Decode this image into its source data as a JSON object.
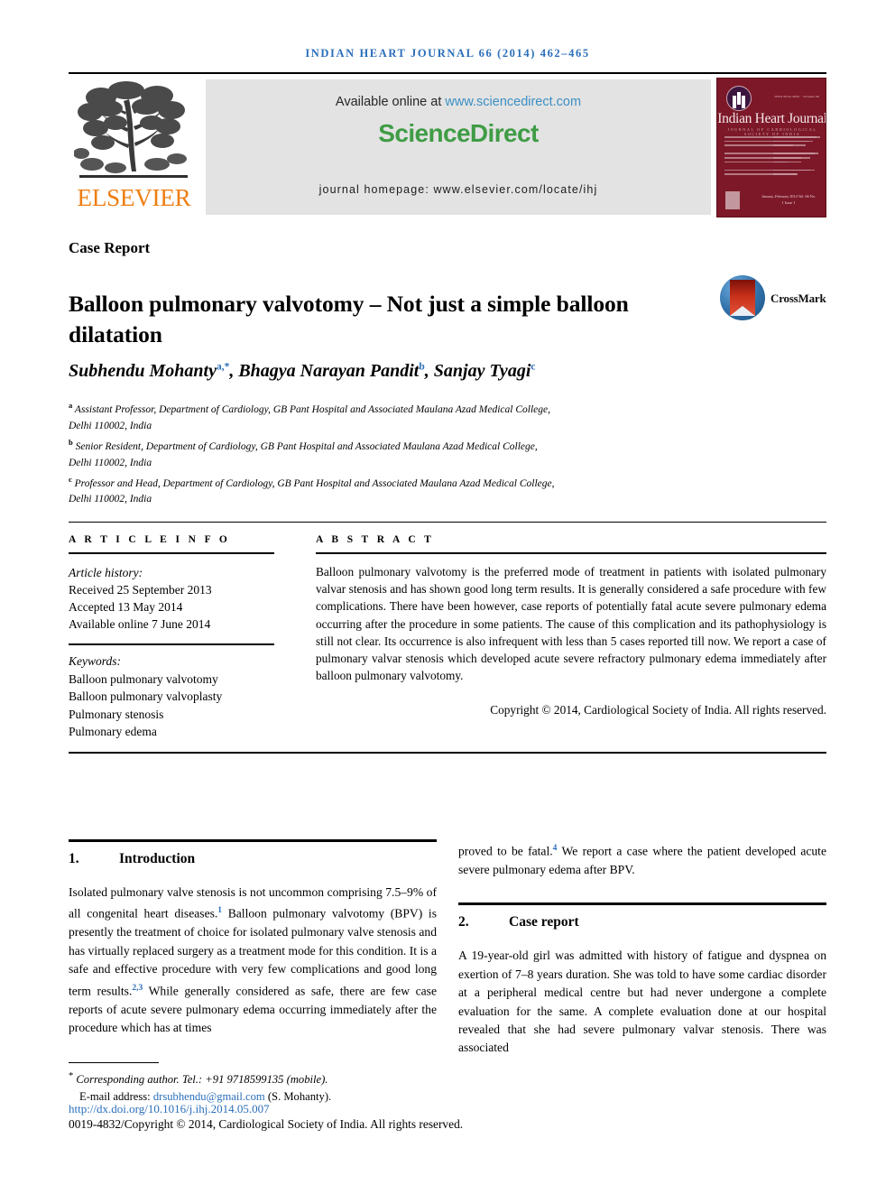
{
  "running_head": "INDIAN HEART JOURNAL 66 (2014) 462–465",
  "masthead": {
    "publisher_name": "ELSEVIER",
    "available_prefix": "Available online at ",
    "available_url": "www.sciencedirect.com",
    "sciencedirect_logo": "ScienceDirect",
    "journal_homepage": "journal homepage: www.elsevier.com/locate/ihj",
    "cover": {
      "title": "Indian Heart Journal",
      "subtitle": "JOURNAL OF CARDIOLOGICAL SOCIETY OF INDIA",
      "volume_note": "ISSN 0019-4832 · Volume 66",
      "footer_note": "January–February 2014 Vol. 66 No. 1\nIssue 1"
    },
    "colors": {
      "sciencedirect_green": "#3f9c45",
      "elsevier_orange": "#ee7d11",
      "link_blue": "#3b8fc4",
      "cover_maroon": "#7c1828"
    }
  },
  "article": {
    "type_label": "Case Report",
    "title": "Balloon pulmonary valvotomy – Not just a simple balloon dilatation",
    "crossmark_label": "CrossMark",
    "authors": [
      {
        "name": "Subhendu Mohanty",
        "marks": "a,*"
      },
      {
        "name": "Bhagya Narayan Pandit",
        "marks": "b"
      },
      {
        "name": "Sanjay Tyagi",
        "marks": "c"
      }
    ],
    "affiliations": [
      {
        "mark": "a",
        "line1": "Assistant Professor, Department of Cardiology, GB Pant Hospital and Associated Maulana Azad Medical College,",
        "line2": "Delhi 110002, India"
      },
      {
        "mark": "b",
        "line1": "Senior Resident, Department of Cardiology, GB Pant Hospital and Associated Maulana Azad Medical College,",
        "line2": "Delhi 110002, India"
      },
      {
        "mark": "c",
        "line1": "Professor and Head, Department of Cardiology, GB Pant Hospital and Associated Maulana Azad Medical College,",
        "line2": "Delhi 110002, India"
      }
    ]
  },
  "article_info": {
    "heading": "A R T I C L E   I N F O",
    "history_label": "Article history:",
    "received": "Received 25 September 2013",
    "accepted": "Accepted 13 May 2014",
    "available_online": "Available online 7 June 2014",
    "keywords_label": "Keywords:",
    "keywords": [
      "Balloon pulmonary valvotomy",
      "Balloon pulmonary valvoplasty",
      "Pulmonary stenosis",
      "Pulmonary edema"
    ]
  },
  "abstract": {
    "heading": "A B S T R A C T",
    "text": "Balloon pulmonary valvotomy is the preferred mode of treatment in patients with isolated pulmonary valvar stenosis and has shown good long term results. It is generally considered a safe procedure with few complications. There have been however, case reports of potentially fatal acute severe pulmonary edema occurring after the procedure in some patients. The cause of this complication and its pathophysiology is still not clear. Its occurrence is also infrequent with less than 5 cases reported till now. We report a case of pulmonary valvar stenosis which developed acute severe refractory pulmonary edema immediately after balloon pulmonary valvotomy.",
    "copyright": "Copyright © 2014, Cardiological Society of India. All rights reserved."
  },
  "sections": {
    "introduction": {
      "number": "1.",
      "title": "Introduction",
      "paragraph_part1": "Isolated pulmonary valve stenosis is not uncommon comprising 7.5–9% of all congenital heart diseases.",
      "ref1": "1",
      "paragraph_part2": " Balloon pulmonary valvotomy (BPV) is presently the treatment of choice for isolated pulmonary valve stenosis and has virtually replaced surgery as a treatment mode for this condition. It is a safe and effective procedure with very few complications and good long term results.",
      "ref2": "2,3",
      "paragraph_part3": " While generally considered as safe, there are few case reports of acute severe pulmonary edema occurring immediately after the procedure which has at times"
    },
    "continuation": {
      "part1": "proved to be fatal.",
      "ref": "4",
      "part2": " We report a case where the patient developed acute severe pulmonary edema after BPV."
    },
    "case_report": {
      "number": "2.",
      "title": "Case report",
      "paragraph": "A 19-year-old girl was admitted with history of fatigue and dyspnea on exertion of 7–8 years duration. She was told to have some cardiac disorder at a peripheral medical centre but had never undergone a complete evaluation for the same. A complete evaluation done at our hospital revealed that she had severe pulmonary valvar stenosis. There was associated"
    }
  },
  "footer": {
    "corresponding_marker": "*",
    "corresponding_text": "Corresponding author. Tel.: +91 9718599135 (mobile).",
    "email_label": "E-mail address: ",
    "email": "drsubhendu@gmail.com",
    "email_owner": " (S. Mohanty).",
    "doi": "http://dx.doi.org/10.1016/j.ihj.2014.05.007",
    "issn_copyright": "0019-4832/Copyright © 2014, Cardiological Society of India. All rights reserved."
  }
}
